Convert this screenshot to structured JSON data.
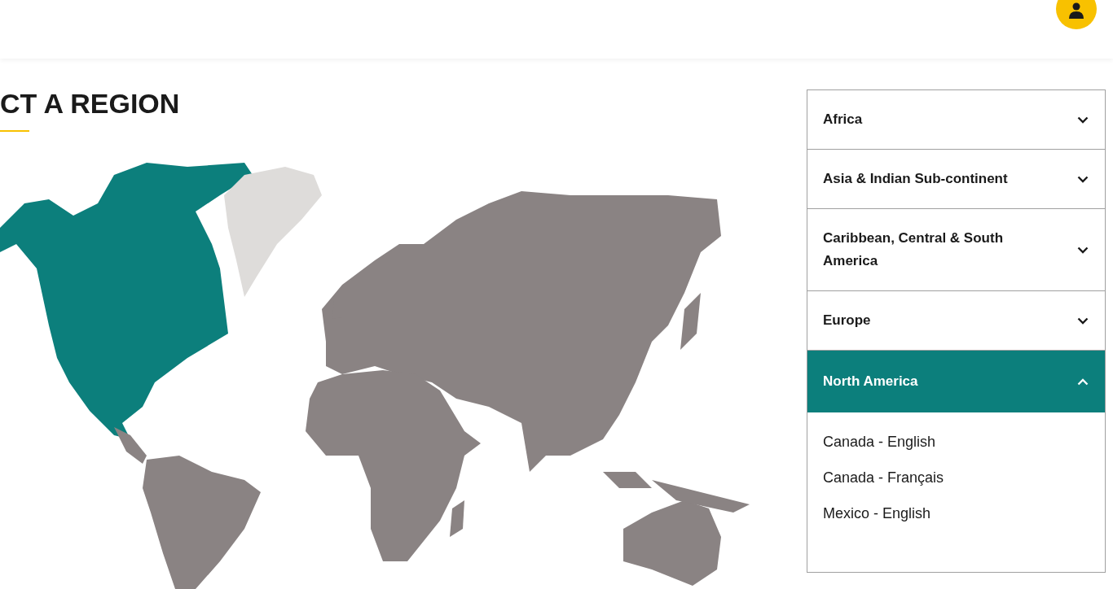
{
  "page_title": "CT A REGION",
  "regions": [
    {
      "label": "Africa",
      "expanded": false
    },
    {
      "label": "Asia & Indian Sub-continent",
      "expanded": false
    },
    {
      "label": "Caribbean, Central & South America",
      "expanded": false
    },
    {
      "label": "Europe",
      "expanded": false
    },
    {
      "label": "North America",
      "expanded": true,
      "items": [
        "Canada - English",
        "Canada - Français",
        "Mexico - English"
      ]
    }
  ]
}
